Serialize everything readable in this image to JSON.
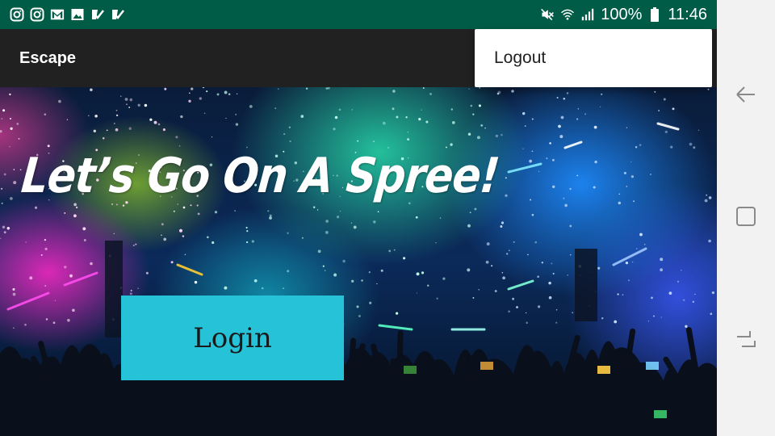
{
  "status_bar": {
    "battery": "100%",
    "time": "11:46",
    "left_icons": [
      "instagram-icon",
      "instagram-icon",
      "gmail-icon",
      "gallery-icon",
      "app-check-icon",
      "app-check-icon"
    ],
    "right_icons": [
      "mute-icon",
      "wifi-icon",
      "signal-icon",
      "battery-icon"
    ]
  },
  "app_bar": {
    "title": "Escape"
  },
  "overflow_menu": {
    "items": [
      {
        "label": "Logout"
      }
    ]
  },
  "main": {
    "headline": "Let’s Go On A Spree!",
    "login_label": "Login"
  },
  "nav_bar": {
    "buttons": [
      "back-icon",
      "recents-icon",
      "home-icon"
    ]
  },
  "colors": {
    "status_bar_bg": "#005c47",
    "app_bar_bg": "#212121",
    "login_button_bg": "#26c3d8",
    "menu_bg": "#ffffff",
    "nav_bar_bg": "#f2f2f2"
  }
}
